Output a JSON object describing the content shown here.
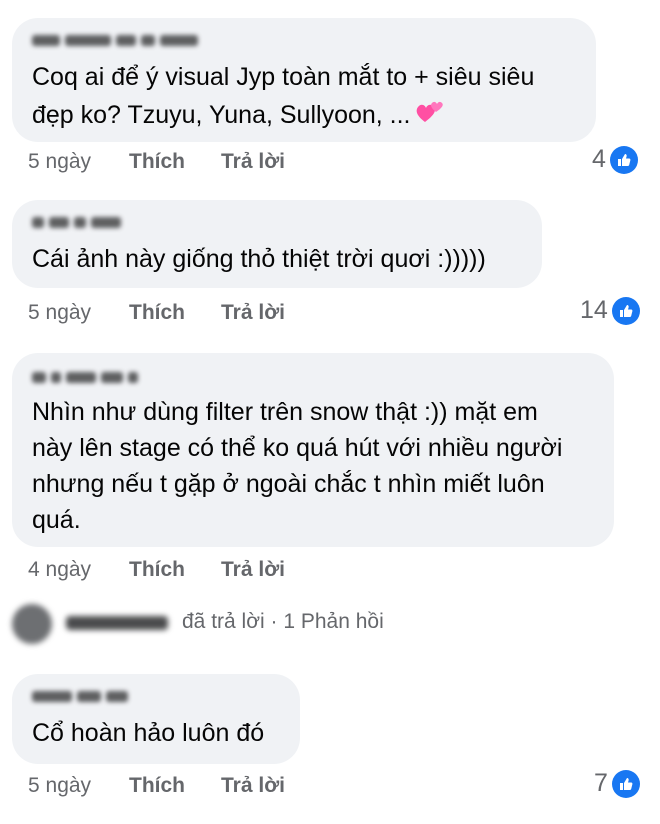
{
  "comments": [
    {
      "lines": [
        "Coq ai để ý visual Jyp toàn mắt to + siêu siêu",
        "đẹp ko? Tzuyu, Yuna, Sullyoon, ..."
      ],
      "time": "5 ngày",
      "like": "Thích",
      "reply": "Trả lời",
      "reaction_count": "4"
    },
    {
      "lines": [
        "Cái ảnh này giống thỏ thiệt trời quơi :)))))"
      ],
      "time": "5 ngày",
      "like": "Thích",
      "reply": "Trả lời",
      "reaction_count": "14"
    },
    {
      "lines": [
        "Nhìn như dùng filter trên snow thật :)) mặt em",
        "này lên stage có thể ko quá hút với nhiều người",
        "nhưng nếu t gặp ở ngoài chắc t nhìn miết luôn",
        "quá."
      ],
      "time": "4 ngày",
      "like": "Thích",
      "reply": "Trả lời",
      "reaction_count": ""
    },
    {
      "lines": [
        "Cổ hoàn hảo luôn đó"
      ],
      "time": "5 ngày",
      "like": "Thích",
      "reply": "Trả lời",
      "reaction_count": "7"
    }
  ],
  "reply_summary": {
    "action": "đã trả lời",
    "separator": "·",
    "count": "1 Phản hồi"
  },
  "icons": {
    "reaction": "like-icon",
    "emoji": "two-hearts-emoji"
  },
  "colors": {
    "bubble": "#f0f2f5",
    "meta": "#65676b",
    "like_blue": "#1877f2",
    "heart_pink": "#ff4fa3"
  }
}
